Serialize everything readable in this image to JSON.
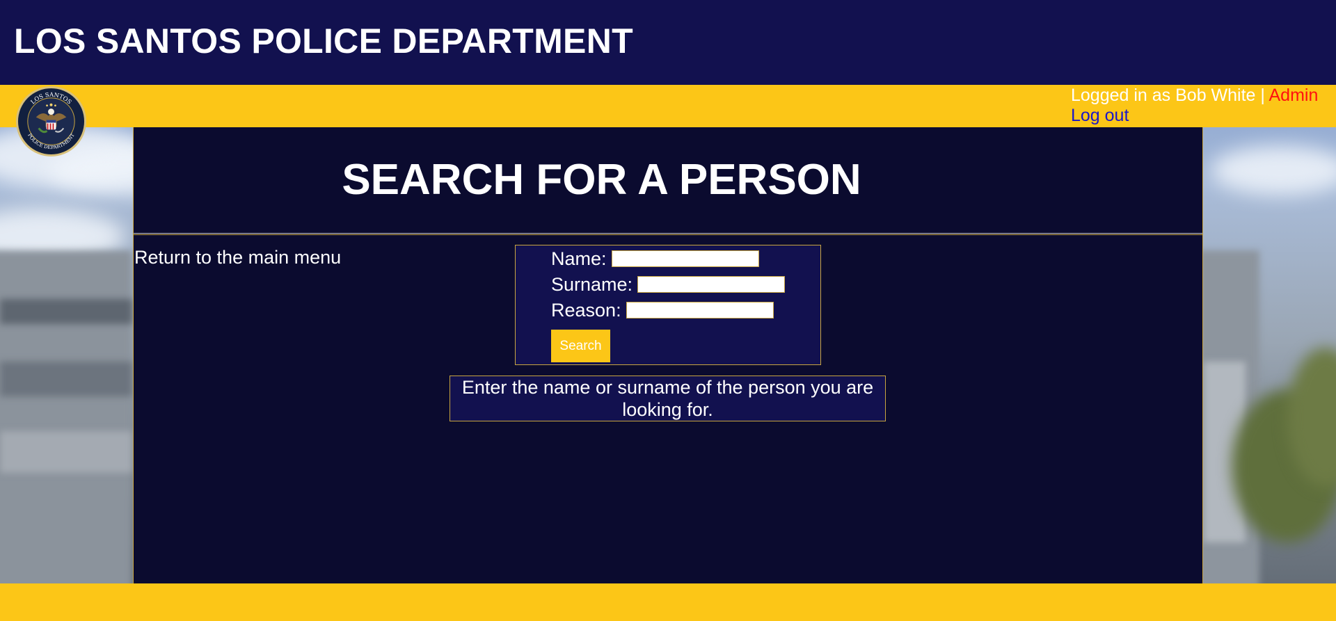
{
  "header": {
    "title": "LOS SANTOS POLICE DEPARTMENT"
  },
  "badge": {
    "icon": "police-badge-eagle-seal",
    "text_top": "LOS SANTOS",
    "text_bottom": "POLICE DEPARTMENT"
  },
  "user": {
    "status_text": "Logged in as Bob White",
    "separator": " | ",
    "admin_label": "Admin",
    "logout_label": "Log out"
  },
  "page": {
    "heading": "SEARCH FOR A PERSON",
    "return_label": "Return to the main menu"
  },
  "form": {
    "name_label": "Name:",
    "name_value": "",
    "surname_label": "Surname:",
    "surname_value": "",
    "reason_label": "Reason:",
    "reason_value": "",
    "search_label": "Search"
  },
  "hint": {
    "text": "Enter the name or surname of the person you are looking for."
  },
  "colors": {
    "header_bg": "#12114f",
    "accent_yellow": "#fcc617",
    "panel_bg": "#0b0b2f",
    "border_gold": "#c9a640",
    "admin_red": "#ff1010",
    "logout_blue": "#1a17c9"
  }
}
